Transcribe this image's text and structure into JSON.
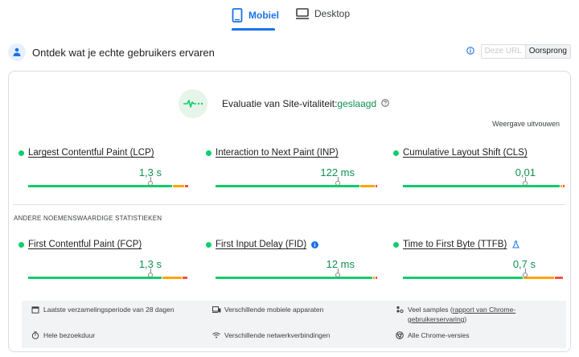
{
  "tabs": [
    {
      "label": "Mobiel",
      "icon": "phone-icon",
      "active": true
    },
    {
      "label": "Desktop",
      "icon": "monitor-icon",
      "active": false
    }
  ],
  "crux": {
    "title": "Ontdek wat je echte gebruikers ervaren",
    "scope_options": [
      {
        "label": "Deze URL",
        "active": false
      },
      {
        "label": "Oorsprong",
        "active": true
      }
    ]
  },
  "assessment": {
    "label": "Evaluatie van Site-vitaliteit:",
    "result": "geslaagd",
    "expand_label": "Weergave uitvouwen"
  },
  "core_metrics": [
    {
      "name": "Largest Contentful Paint (LCP)",
      "value": "1,3 s",
      "status": "good",
      "distribution": {
        "good": 0.88,
        "needs_improvement": 0.07,
        "poor": 0.02
      },
      "marker": 0.75
    },
    {
      "name": "Interaction to Next Paint (INP)",
      "value": "122 ms",
      "status": "good",
      "distribution": {
        "good": 0.88,
        "needs_improvement": 0.09,
        "poor": 0.01
      },
      "marker": 0.75
    },
    {
      "name": "Cumulative Layout Shift (CLS)",
      "value": "0,01",
      "status": "good",
      "distribution": {
        "good": 0.98,
        "needs_improvement": 0.01,
        "poor": 0.01
      },
      "marker": 0.75
    }
  ],
  "other_heading": "ANDERE NOEMENSWAARDIGE STATISTIEKEN",
  "other_metrics": [
    {
      "name": "First Contentful Paint (FCP)",
      "value": "1,3 s",
      "status": "good",
      "badge": "info-icon",
      "distribution": {
        "good": 0.82,
        "needs_improvement": 0.12,
        "poor": 0.03
      },
      "marker": 0.75
    },
    {
      "name": "First Input Delay (FID)",
      "value": "12 ms",
      "status": "good",
      "badge": "deprecated-info-icon",
      "distribution": {
        "good": 0.96,
        "needs_improvement": 0.01,
        "poor": 0.01
      },
      "marker": 0.75
    },
    {
      "name": "Time to First Byte (TTFB)",
      "value": "0,7 s",
      "status": "good",
      "badge": "experimental-flask-icon",
      "distribution": {
        "good": 0.74,
        "needs_improvement": 0.19,
        "poor": 0.05
      },
      "marker": 0.75
    }
  ],
  "colors": {
    "good": "#0cce6b",
    "needs_improvement": "#ffa400",
    "poor": "#ff4e42",
    "accent": "#1a73e8",
    "pass_text": "#0d904f"
  },
  "footer": {
    "collection_period": "Laatste verzamelingsperiode van 28 dagen",
    "devices": "Verschillende mobiele apparaten",
    "samples_prefix": "Veel samples (",
    "samples_link": "rapport van Chrome-gebruikerservaring",
    "samples_suffix": ")",
    "duration": "Hele bezoekduur",
    "network": "Verschillende netwerkverbindingen",
    "versions": "Alle Chrome-versies"
  }
}
